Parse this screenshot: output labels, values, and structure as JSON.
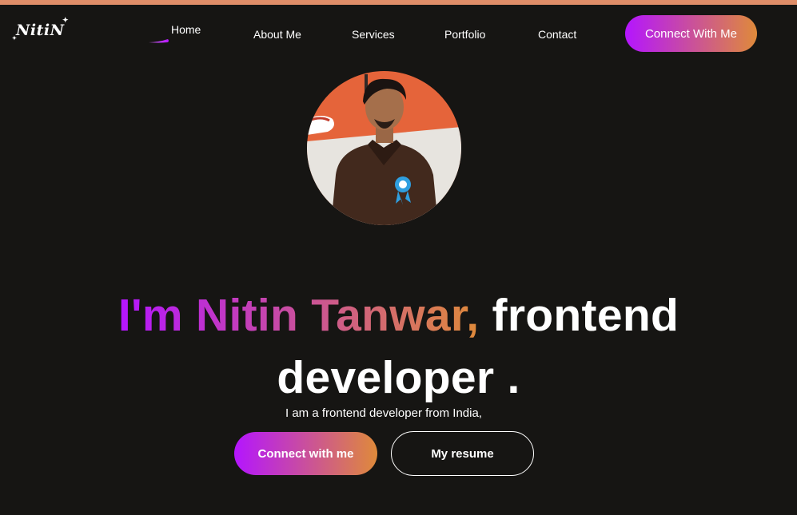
{
  "brand": {
    "logo_text": "NitiN"
  },
  "nav": {
    "items": [
      {
        "label": "Home",
        "active": true
      },
      {
        "label": "About Me"
      },
      {
        "label": "Services"
      },
      {
        "label": "Portfolio"
      },
      {
        "label": "Contact"
      }
    ],
    "cta_label": "Connect With Me"
  },
  "hero": {
    "name_part": "I'm Nitin Tanwar,",
    "role_part_1": "frontend",
    "role_part_2": "developer .",
    "subtitle": "I am a frontend developer from India,",
    "primary_button": "Connect with me",
    "secondary_button": "My resume"
  },
  "colors": {
    "background": "#161513",
    "top_strip": "#df8d68",
    "gradient_start": "#b415ff",
    "gradient_end": "#df8a3a",
    "text": "#ffffff"
  }
}
